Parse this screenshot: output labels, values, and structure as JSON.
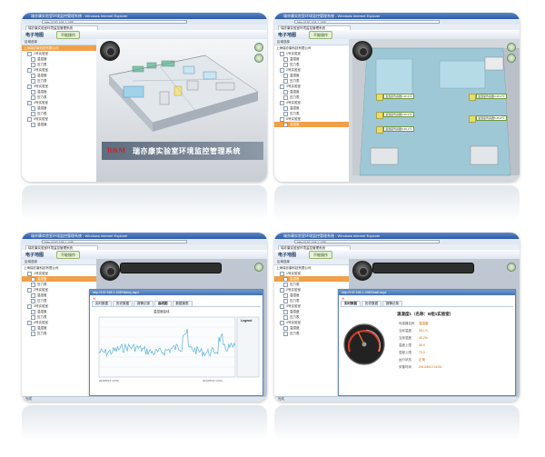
{
  "browser": {
    "window_title": "瑞亦康实验室环境监控管理系统 - Windows Internet Explorer",
    "address": "http://192.168.1.108/",
    "tab_title": "瑞亦康实验室环境监控管理系统"
  },
  "app": {
    "title": "电子地图",
    "button_label": "不能操作",
    "tree_header": "区域选择",
    "tree_root": "上海瑞亦康科技有限公司",
    "tree_items": [
      "1号实验室",
      "温湿度",
      "压力表",
      "2号实验室",
      "温湿度",
      "压力表",
      "3号实验室",
      "温湿度",
      "压力表",
      "4号实验室",
      "温湿度",
      "压力表",
      "5号实验室",
      "温湿度"
    ],
    "selected_item_index": 13
  },
  "panel1": {
    "logo": "R&M",
    "caption": "瑞亦康实验室环境监控管理系统"
  },
  "panel2": {
    "tags": [
      "温湿度传感器1 26.3℃",
      "温湿度传感器2 25.9℃",
      "温湿度传感器3 26.1℃",
      "温湿度传感器4 26.0℃",
      "温湿度传感器5 25.8℃"
    ]
  },
  "panel3": {
    "popup_url": "http://192.168.1.108/History.aspx",
    "tabs": [
      "实时数据",
      "历史数据",
      "报警记录",
      "曲线图",
      "数据报表"
    ],
    "legend_label": "Legend",
    "x_start": "2013/5/13 14:50",
    "x_end": "2013/5/13 14:54",
    "chart_title": "温湿度曲线"
  },
  "panel4": {
    "popup_url": "http://192.168.1.108/Detail.aspx",
    "tabs": [
      "实时数据",
      "历史数据",
      "报警记录"
    ],
    "title": "温湿度1（名称：B组1实验室）",
    "rows": [
      {
        "label": "传感器名称",
        "value": "温湿度"
      },
      {
        "label": "当前温度",
        "value": "26.1℃"
      },
      {
        "label": "当前湿度",
        "value": "45.2%"
      },
      {
        "label": "温度上限",
        "value": "30.0"
      },
      {
        "label": "湿度上限",
        "value": "70.0"
      },
      {
        "label": "运行状态",
        "value": "正常"
      },
      {
        "label": "采集时间",
        "value": "2013/5/13 14:54"
      }
    ]
  },
  "statusbar": {
    "text": "完成"
  },
  "colors": {
    "title_blue": "#2e5aa6",
    "selected_orange": "#f0a048",
    "chart_line": "#5fb3d6"
  }
}
